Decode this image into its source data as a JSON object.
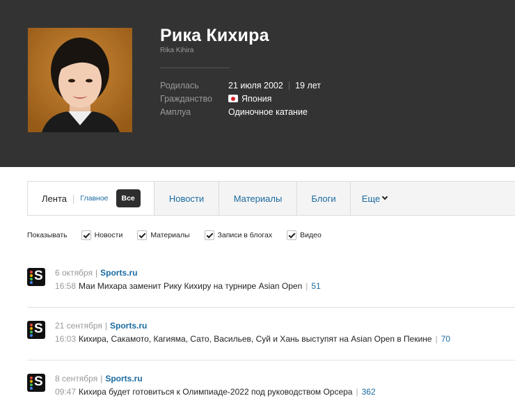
{
  "profile": {
    "name": "Рика Кихира",
    "latin_name": "Rika Kihira",
    "born_label": "Родилась",
    "born_date": "21 июля 2002",
    "age": "19 лет",
    "citizenship_label": "Гражданство",
    "citizenship": "Япония",
    "role_label": "Амплуа",
    "role": "Одиночное катание",
    "flag_icon": "japan-flag-icon"
  },
  "tabs": {
    "feed": "Лента",
    "main": "Главное",
    "all": "Все",
    "items": [
      "Новости",
      "Материалы",
      "Блоги",
      "Еще"
    ]
  },
  "filters": {
    "show_label": "Показывать",
    "options": [
      "Новости",
      "Материалы",
      "Записи в блогах",
      "Видео"
    ]
  },
  "news": [
    {
      "date": "6 октября",
      "source": "Sports.ru",
      "time": "16:58",
      "title": "Маи Михара заменит Рику Кихиру на турнире Asian Open",
      "comments": "51"
    },
    {
      "date": "21 сентября",
      "source": "Sports.ru",
      "time": "16:03",
      "title": "Кихира, Сакамото, Кагияма, Сато, Васильев, Суй и Хань выступят на Asian Open в Пекине",
      "comments": "70"
    },
    {
      "date": "8 сентября",
      "source": "Sports.ru",
      "time": "09:47",
      "title": "Кихира будет готовиться к Олимпиаде-2022 под руководством Орсера",
      "comments": "362"
    }
  ],
  "colors": {
    "header_bg": "#333333",
    "link": "#1a6aa0",
    "active_tab": "#2e2e2e"
  }
}
